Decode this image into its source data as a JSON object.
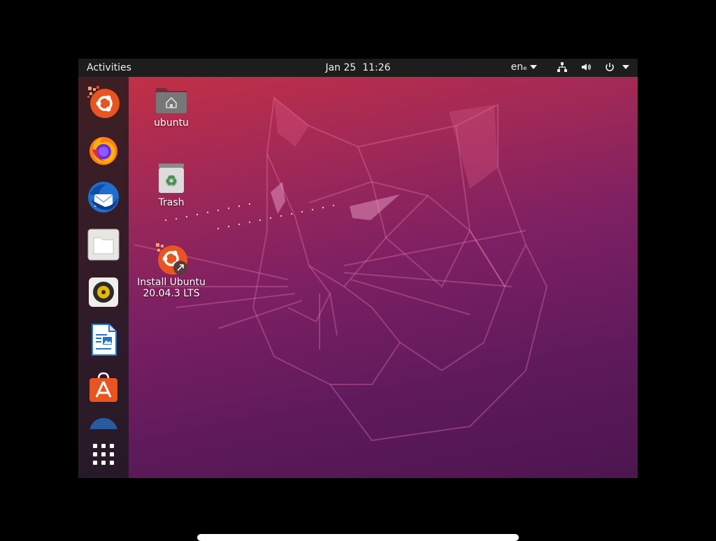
{
  "topbar": {
    "activities": "Activities",
    "date": "Jan 25",
    "time": "11:26",
    "language": "enₑ"
  },
  "dock": {
    "items": [
      {
        "name": "ubuntu-installer"
      },
      {
        "name": "firefox"
      },
      {
        "name": "thunderbird"
      },
      {
        "name": "files"
      },
      {
        "name": "rhythmbox"
      },
      {
        "name": "libreoffice-writer"
      },
      {
        "name": "ubuntu-software"
      },
      {
        "name": "help"
      }
    ],
    "show_apps": "show-applications"
  },
  "desktop": {
    "icons": [
      {
        "label": "ubuntu"
      },
      {
        "label": "Trash"
      },
      {
        "label": "Install Ubuntu 20.04.3 LTS"
      }
    ]
  },
  "colors": {
    "accent": "#e95420",
    "topbar": "#1d1d1d",
    "wallpaper_top": "#c53045",
    "wallpaper_bottom": "#4d1550"
  }
}
